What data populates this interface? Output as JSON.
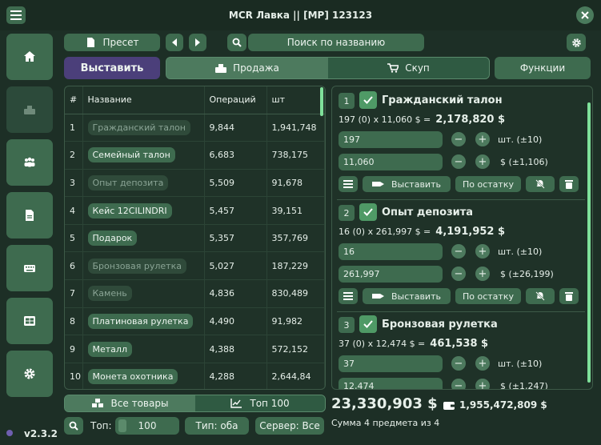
{
  "title": "MCR Лавка || [MP]  123123",
  "version": "v2.3.2",
  "toolbar": {
    "preset": "Пресет",
    "search": "Поиск по названию"
  },
  "tabs": {
    "post": "Выставить",
    "sell": "Продажа",
    "buy": "Скуп",
    "functions": "Функции"
  },
  "table": {
    "headers": [
      "#",
      "Название",
      "Операций",
      "шт"
    ],
    "rows": [
      {
        "n": "1",
        "name": "Гражданский талон",
        "ops": "9,844",
        "qty": "1,941,748",
        "dim": true
      },
      {
        "n": "2",
        "name": "Семейный талон",
        "ops": "6,683",
        "qty": "738,175",
        "dim": false
      },
      {
        "n": "3",
        "name": "Опыт депозита",
        "ops": "5,509",
        "qty": "91,678",
        "dim": true
      },
      {
        "n": "4",
        "name": "Кейс 12CILINDRI",
        "ops": "5,457",
        "qty": "39,151",
        "dim": false
      },
      {
        "n": "5",
        "name": "Подарок",
        "ops": "5,357",
        "qty": "357,769",
        "dim": false
      },
      {
        "n": "6",
        "name": "Бронзовая рулетка",
        "ops": "5,027",
        "qty": "187,229",
        "dim": true
      },
      {
        "n": "7",
        "name": "Камень",
        "ops": "4,836",
        "qty": "830,489",
        "dim": true
      },
      {
        "n": "8",
        "name": "Платиновая рулетка",
        "ops": "4,490",
        "qty": "91,982",
        "dim": false
      },
      {
        "n": "9",
        "name": "Металл",
        "ops": "4,388",
        "qty": "572,152",
        "dim": false
      },
      {
        "n": "10",
        "name": "Монета охотника",
        "ops": "4,288",
        "qty": "2,644,84",
        "dim": false
      }
    ]
  },
  "cards": [
    {
      "n": "1",
      "name": "Гражданский талон",
      "formula": "197 (0) x 11,060 $  =",
      "total": "2,178,820 $",
      "qty": "197",
      "qty_unit": "шт. (±10)",
      "price": "11,060",
      "price_unit": "$  (±1,106)"
    },
    {
      "n": "2",
      "name": "Опыт депозита",
      "formula": "16 (0) x 261,997 $  =",
      "total": "4,191,952 $",
      "qty": "16",
      "qty_unit": "шт. (±10)",
      "price": "261,997",
      "price_unit": "$  (±26,199)"
    },
    {
      "n": "3",
      "name": "Бронзовая рулетка",
      "formula": "37 (0) x 12,474 $  =",
      "total": "461,538 $",
      "qty": "37",
      "qty_unit": "шт. (±10)",
      "price": "12,474",
      "price_unit": "$  (±1,247)"
    }
  ],
  "card_actions": {
    "post": "Выставить",
    "remaining": "По остатку"
  },
  "bottom": {
    "all_goods": "Все товары",
    "top100": "Топ 100",
    "top_label": "Топ:",
    "top_value": "100",
    "type": "Тип: оба",
    "server": "Сервер: Все",
    "sum_total": "23,330,903 $",
    "balance": "1,955,472,809 $",
    "sum_caption": "Сумма 4 предмета из 4"
  },
  "colors": {
    "accent": "#3e6b4f",
    "active_tab": "#4b3f7a",
    "check": "#4f9a66",
    "background": "#1d2f26"
  }
}
